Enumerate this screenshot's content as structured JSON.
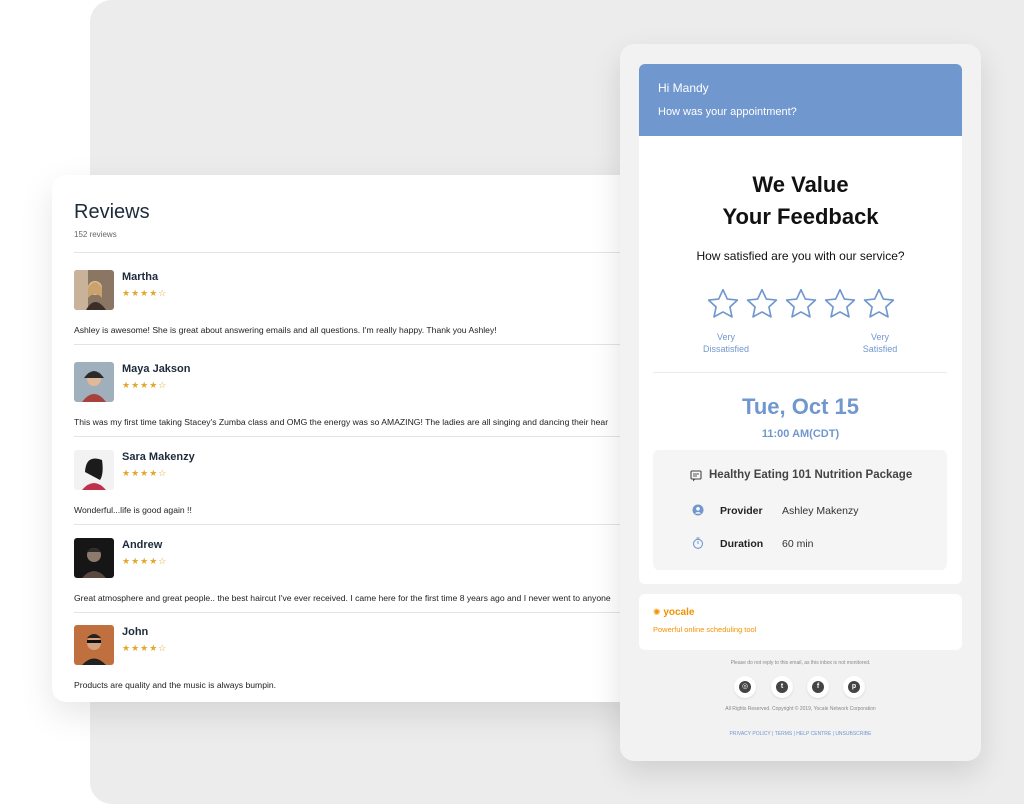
{
  "reviews": {
    "title": "Reviews",
    "count": "152 reviews",
    "items": [
      {
        "name": "Martha",
        "stars": "★★★★☆",
        "text": "Ashley is awesome! She is great about answering emails and all questions. I'm really happy. Thank you Ashley!"
      },
      {
        "name": "Maya Jakson",
        "stars": "★★★★☆",
        "text": "This was my first time taking Stacey's Zumba class and OMG the energy was so AMAZING! The ladies are all singing and dancing their hear"
      },
      {
        "name": "Sara Makenzy",
        "stars": "★★★★☆",
        "text": "Wonderful...life is good again !!"
      },
      {
        "name": "Andrew",
        "stars": "★★★★☆",
        "text": "Great atmosphere and great people.. the best haircut I've ever received. I came here for the first time 8 years ago and I never went to anyone"
      },
      {
        "name": "John",
        "stars": "★★★★☆",
        "text": "Products are quality and the music is always bumpin."
      }
    ]
  },
  "email": {
    "greeting": "Hi Mandy",
    "question": "How was your appointment?",
    "headline_line1": "We Value",
    "headline_line2": "Your Feedback",
    "satisfaction_question": "How satisfied are you with our service?",
    "low_label": "Very\nDissatisfied",
    "high_label": "Very\nSatisfied",
    "date": "Tue, Oct 15",
    "time": "11:00 AM(CDT)",
    "package": "Healthy Eating 101 Nutrition Package",
    "provider_label": "Provider",
    "provider_value": "Ashley Makenzy",
    "duration_label": "Duration",
    "duration_value": "60 min",
    "brand_name": "yocale",
    "brand_tagline": "Powerful online scheduling tool",
    "no_reply_note": "Please do not reply to this email, as this inbox is not monitored.",
    "copyright": "All Rights Reserved. Copyright © 2019, Yocale Network Corporation",
    "links": {
      "privacy": "PRIVACY POLICY",
      "terms": "TERMS",
      "help": "HELP CENTRE",
      "unsubscribe": "UNSUBSCRIBE"
    },
    "social_icons": [
      "instagram-icon",
      "twitter-icon",
      "facebook-icon",
      "pinterest-icon"
    ]
  },
  "colors": {
    "accent_blue": "#7197cf",
    "star_gold": "#e3a72b",
    "brand_orange": "#f29200"
  }
}
